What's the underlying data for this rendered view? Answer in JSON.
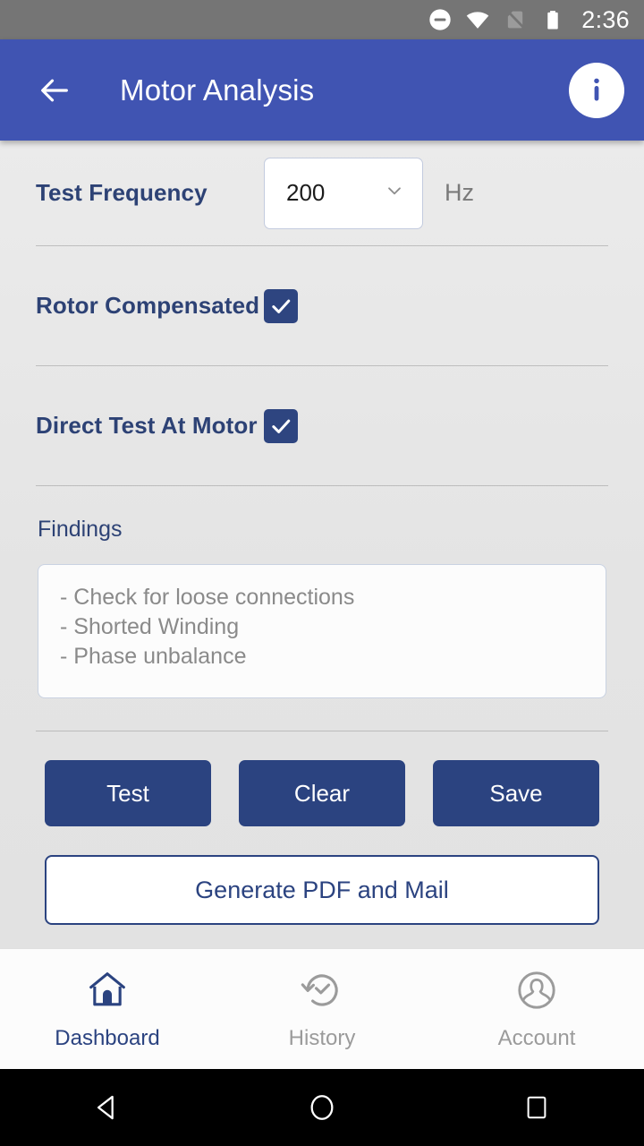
{
  "status_bar": {
    "time": "2:36",
    "icons": [
      "do-not-disturb-icon",
      "wifi-icon",
      "no-sim-icon",
      "battery-icon"
    ]
  },
  "app_bar": {
    "title": "Motor Analysis",
    "back_icon": "back-arrow-icon",
    "info_icon": "info-icon",
    "background_color": "#4054B2"
  },
  "form": {
    "frequency": {
      "label": "Test Frequency",
      "value": "200",
      "unit": "Hz",
      "chevron_icon": "chevron-down-icon"
    },
    "rotor_compensated": {
      "label": "Rotor Compensated",
      "checked": true
    },
    "direct_test": {
      "label": "Direct Test At Motor",
      "checked": true
    },
    "findings": {
      "label": "Findings",
      "lines": [
        "- Check for loose connections",
        "- Shorted Winding",
        "- Phase unbalance"
      ],
      "line1": "- Check for loose connections",
      "line2": "- Shorted Winding",
      "line3": "- Phase unbalance"
    }
  },
  "actions": {
    "test": "Test",
    "clear": "Clear",
    "save": "Save",
    "generate_pdf": "Generate PDF and Mail",
    "primary_color": "#2B4380"
  },
  "bottom_nav": {
    "items": [
      {
        "label": "Dashboard",
        "icon": "home-icon",
        "active": true
      },
      {
        "label": "History",
        "icon": "history-icon",
        "active": false
      },
      {
        "label": "Account",
        "icon": "account-icon",
        "active": false
      }
    ]
  },
  "android_nav": {
    "back": "back-triangle-icon",
    "home": "home-circle-icon",
    "recents": "recents-square-icon"
  }
}
